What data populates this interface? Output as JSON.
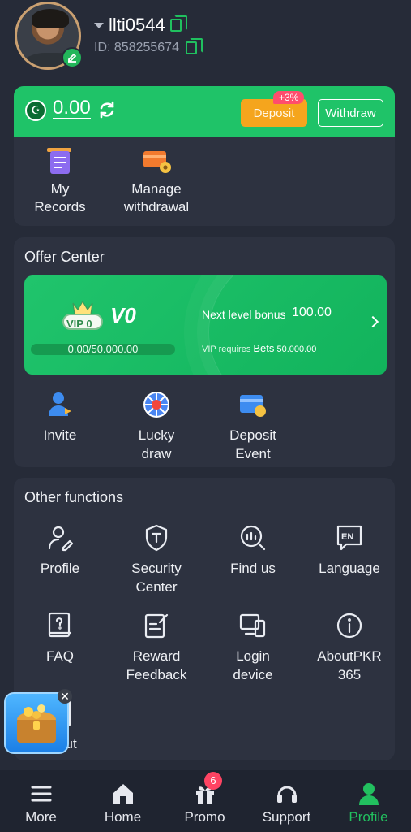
{
  "user": {
    "name": "llti0544",
    "id_label": "ID: 858255674"
  },
  "wallet": {
    "balance": "0.00",
    "deposit_label": "Deposit",
    "deposit_bonus": "+3%",
    "withdraw_label": "Withdraw"
  },
  "quick_actions": [
    {
      "label": "My\nRecords",
      "icon": "records-icon"
    },
    {
      "label": "Manage\nwithdrawal",
      "icon": "manage-withdrawal-icon"
    }
  ],
  "offer": {
    "title": "Offer Center",
    "vip": {
      "badge_text": "VIP 0",
      "level": "V0",
      "progress_text": "0.00/50.000.00",
      "progress": 0,
      "next_bonus_label": "Next level bonus",
      "next_bonus_value": "100.00",
      "requires_label": "VIP requires",
      "requires_link": "Bets",
      "requires_value": "50.000.00"
    },
    "items": [
      {
        "label": "Invite",
        "icon": "invite-icon"
      },
      {
        "label": "Lucky\ndraw",
        "icon": "lucky-draw-icon"
      },
      {
        "label": "Deposit\nEvent",
        "icon": "deposit-event-icon"
      }
    ]
  },
  "other": {
    "title": "Other functions",
    "items": [
      {
        "label": "Profile",
        "icon": "profile-icon"
      },
      {
        "label": "Security\nCenter",
        "icon": "security-icon"
      },
      {
        "label": "Find us",
        "icon": "find-us-icon"
      },
      {
        "label": "Language",
        "icon": "language-icon"
      },
      {
        "label": "FAQ",
        "icon": "faq-icon"
      },
      {
        "label": "Reward\nFeedback",
        "icon": "reward-feedback-icon"
      },
      {
        "label": "Login\ndevice",
        "icon": "login-device-icon"
      },
      {
        "label": "AboutPKR\n365",
        "icon": "about-icon"
      },
      {
        "label": "Out",
        "icon": "logout-icon"
      }
    ],
    "language_badge": "EN"
  },
  "tabbar": {
    "items": [
      {
        "label": "More",
        "icon": "menu-icon"
      },
      {
        "label": "Home",
        "icon": "home-icon"
      },
      {
        "label": "Promo",
        "icon": "gift-icon"
      },
      {
        "label": "Support",
        "icon": "headset-icon"
      },
      {
        "label": "Profile",
        "icon": "person-icon"
      }
    ],
    "active": "Profile",
    "promo_badge": "6"
  },
  "colors": {
    "accent": "#1fc368",
    "deposit": "#f5a51d",
    "badge": "#ff4463",
    "bg": "#262b38",
    "card": "#2d3240"
  }
}
